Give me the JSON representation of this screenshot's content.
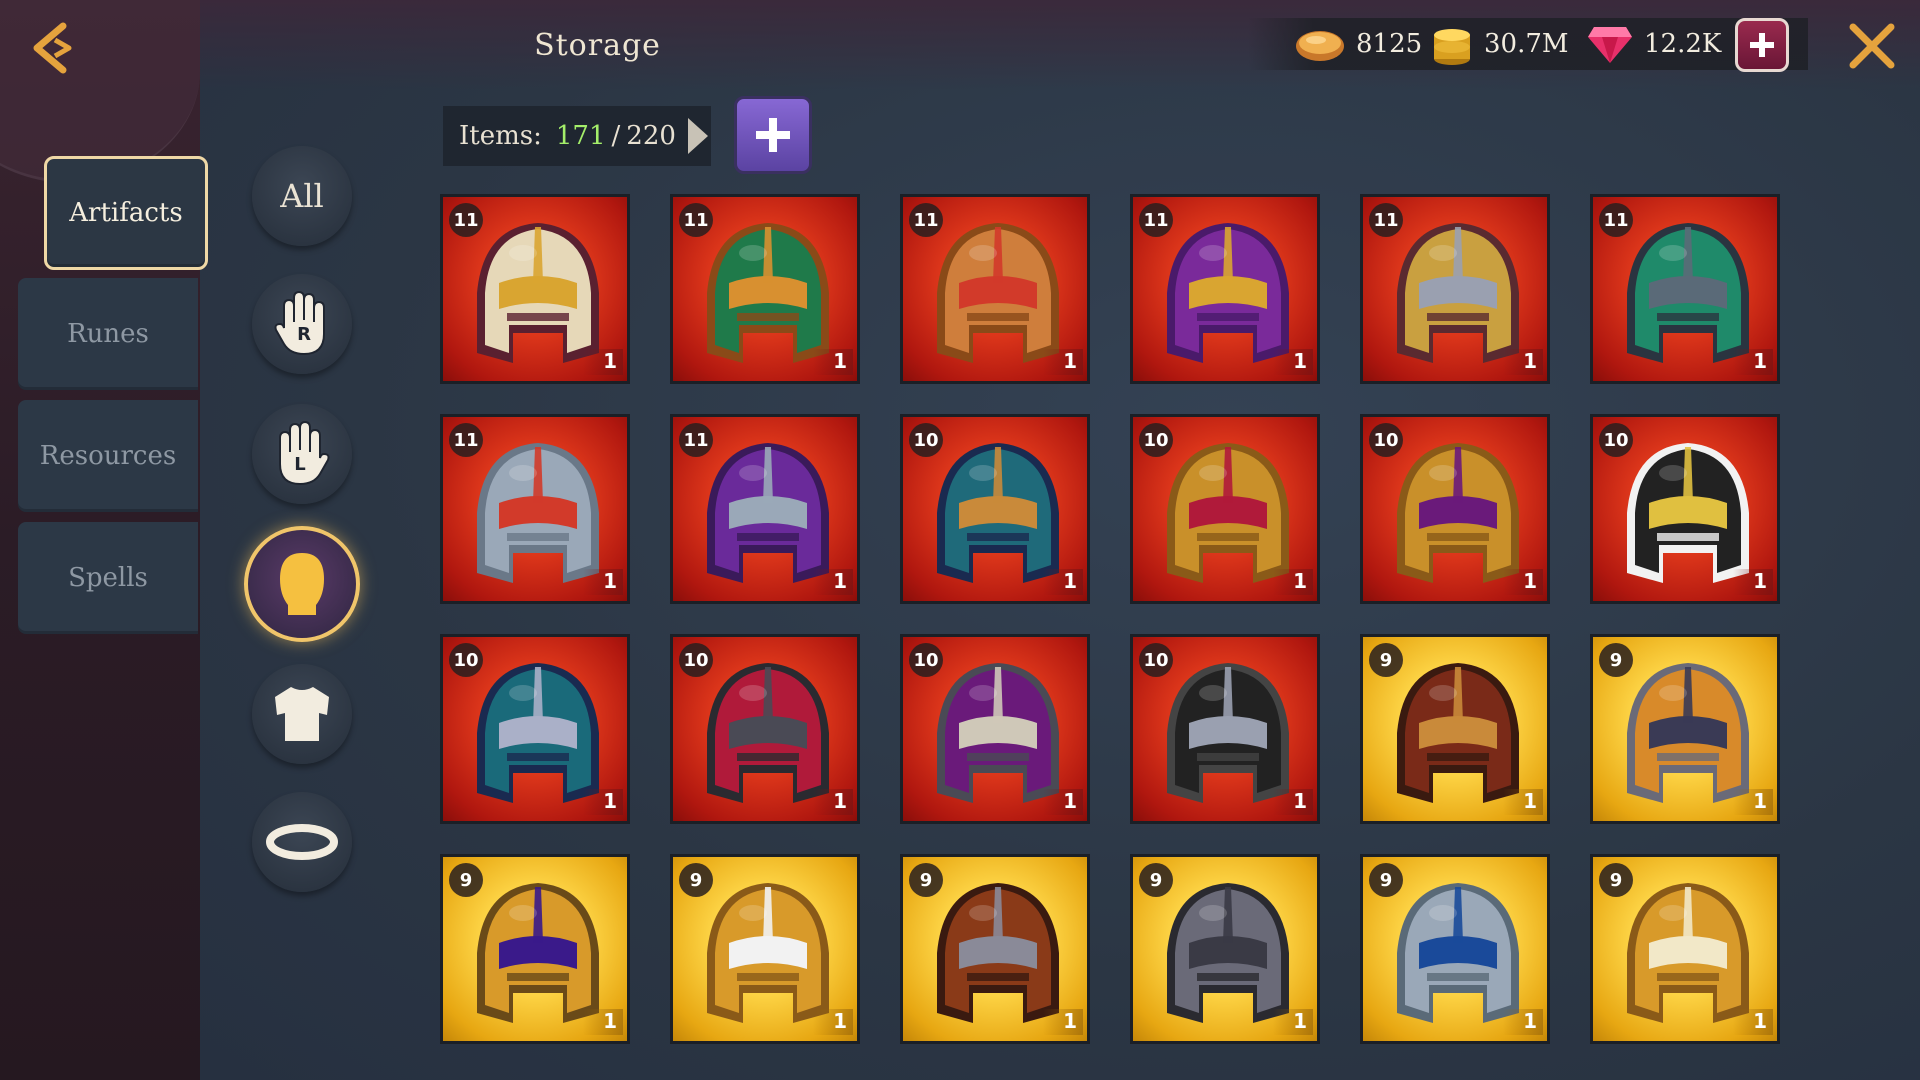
{
  "header": {
    "title": "Storage",
    "back_icon": "back-arrow-icon",
    "close_icon": "close-icon"
  },
  "currency": {
    "bread": "8125",
    "gold": "30.7M",
    "gems": "12.2K"
  },
  "tabs": [
    {
      "label": "Artifacts",
      "active": true
    },
    {
      "label": "Runes",
      "active": false
    },
    {
      "label": "Resources",
      "active": false
    },
    {
      "label": "Spells",
      "active": false
    }
  ],
  "filters": [
    {
      "id": "all",
      "label": "All",
      "active": false
    },
    {
      "id": "right-hand",
      "icon": "right-hand-icon",
      "letter": "R",
      "active": false
    },
    {
      "id": "left-hand",
      "icon": "left-hand-icon",
      "letter": "L",
      "active": false
    },
    {
      "id": "head",
      "icon": "head-icon",
      "active": true
    },
    {
      "id": "body",
      "icon": "torso-icon",
      "active": false
    },
    {
      "id": "ring",
      "icon": "ring-icon",
      "active": false
    }
  ],
  "storage": {
    "items_label": "Items:",
    "current": "171",
    "separator": "/",
    "max": "220"
  },
  "colors": {
    "accent_gold": "#f0c56a",
    "count_green": "#a4ee6a",
    "rarity_red": "#e23a1c",
    "rarity_gold": "#ffd84a"
  },
  "items": [
    {
      "level": "11",
      "qty": "1",
      "rarity": "red",
      "icon": "helmet-icon",
      "colors": [
        "#e6d8b8",
        "#d9a531",
        "#5a2030"
      ]
    },
    {
      "level": "11",
      "qty": "1",
      "rarity": "red",
      "icon": "helmet-icon",
      "colors": [
        "#1f7a4a",
        "#d89030",
        "#8a4a18"
      ]
    },
    {
      "level": "11",
      "qty": "1",
      "rarity": "red",
      "icon": "helmet-icon",
      "colors": [
        "#cf7e3c",
        "#d23a2a",
        "#8a4a18"
      ]
    },
    {
      "level": "11",
      "qty": "1",
      "rarity": "red",
      "icon": "helmet-icon",
      "colors": [
        "#7a2a9a",
        "#d9a531",
        "#4a1a6a"
      ]
    },
    {
      "level": "11",
      "qty": "1",
      "rarity": "red",
      "icon": "helmet-icon",
      "colors": [
        "#c9a040",
        "#9aa0b0",
        "#5a2a30"
      ]
    },
    {
      "level": "11",
      "qty": "1",
      "rarity": "red",
      "icon": "helmet-icon",
      "colors": [
        "#1f8a6a",
        "#5a6a78",
        "#2a3440"
      ]
    },
    {
      "level": "11",
      "qty": "1",
      "rarity": "red",
      "icon": "helmet-icon",
      "colors": [
        "#9aa8b8",
        "#d23a2a",
        "#6a7888"
      ]
    },
    {
      "level": "11",
      "qty": "1",
      "rarity": "red",
      "icon": "helmet-icon",
      "colors": [
        "#6a2a9a",
        "#9aa8b8",
        "#3a1a5a"
      ]
    },
    {
      "level": "10",
      "qty": "1",
      "rarity": "red",
      "icon": "helmet-icon",
      "colors": [
        "#1f6a7a",
        "#c98a3a",
        "#1a2a50"
      ]
    },
    {
      "level": "10",
      "qty": "1",
      "rarity": "red",
      "icon": "helmet-icon",
      "colors": [
        "#c9902a",
        "#b01a3a",
        "#8a5a18"
      ]
    },
    {
      "level": "10",
      "qty": "1",
      "rarity": "red",
      "icon": "helmet-icon",
      "colors": [
        "#c9902a",
        "#6a1a7a",
        "#8a5a18"
      ]
    },
    {
      "level": "10",
      "qty": "1",
      "rarity": "red",
      "icon": "helmet-icon",
      "colors": [
        "#222222",
        "#e0c040",
        "#f2f2f2"
      ]
    },
    {
      "level": "10",
      "qty": "1",
      "rarity": "red",
      "icon": "helmet-icon",
      "colors": [
        "#1a6a7a",
        "#aab0c8",
        "#1a2a50"
      ]
    },
    {
      "level": "10",
      "qty": "1",
      "rarity": "red",
      "icon": "helmet-icon",
      "colors": [
        "#b01a3a",
        "#4a4a55",
        "#2a2a30"
      ]
    },
    {
      "level": "10",
      "qty": "1",
      "rarity": "red",
      "icon": "helmet-icon",
      "colors": [
        "#6a1a7a",
        "#cfc8b8",
        "#4a4a55"
      ]
    },
    {
      "level": "10",
      "qty": "1",
      "rarity": "red",
      "icon": "helmet-icon",
      "colors": [
        "#222222",
        "#9aa0b0",
        "#444444"
      ]
    },
    {
      "level": "9",
      "qty": "1",
      "rarity": "gold",
      "icon": "helmet-icon",
      "colors": [
        "#7a2a18",
        "#c98a3a",
        "#3a1a10"
      ]
    },
    {
      "level": "9",
      "qty": "1",
      "rarity": "gold",
      "icon": "helmet-icon",
      "colors": [
        "#d88a2a",
        "#3a3a55",
        "#6a6a78"
      ]
    },
    {
      "level": "9",
      "qty": "1",
      "rarity": "gold",
      "icon": "helmet-icon",
      "colors": [
        "#d89a2a",
        "#3a1a8a",
        "#6a4a18"
      ]
    },
    {
      "level": "9",
      "qty": "1",
      "rarity": "gold",
      "icon": "helmet-icon",
      "colors": [
        "#d89a2a",
        "#f2f2f2",
        "#8a5a18"
      ]
    },
    {
      "level": "9",
      "qty": "1",
      "rarity": "gold",
      "icon": "helmet-icon",
      "colors": [
        "#8a3a18",
        "#8a8a98",
        "#3a1a10"
      ]
    },
    {
      "level": "9",
      "qty": "1",
      "rarity": "gold",
      "icon": "helmet-icon",
      "colors": [
        "#6a6a78",
        "#3a3a45",
        "#2a2a30"
      ]
    },
    {
      "level": "9",
      "qty": "1",
      "rarity": "gold",
      "icon": "helmet-icon",
      "colors": [
        "#9aa8b8",
        "#1a4a9a",
        "#5a6a78"
      ]
    },
    {
      "level": "9",
      "qty": "1",
      "rarity": "gold",
      "icon": "helmet-icon",
      "colors": [
        "#d89a2a",
        "#f2e8c8",
        "#8a5a18"
      ]
    }
  ]
}
